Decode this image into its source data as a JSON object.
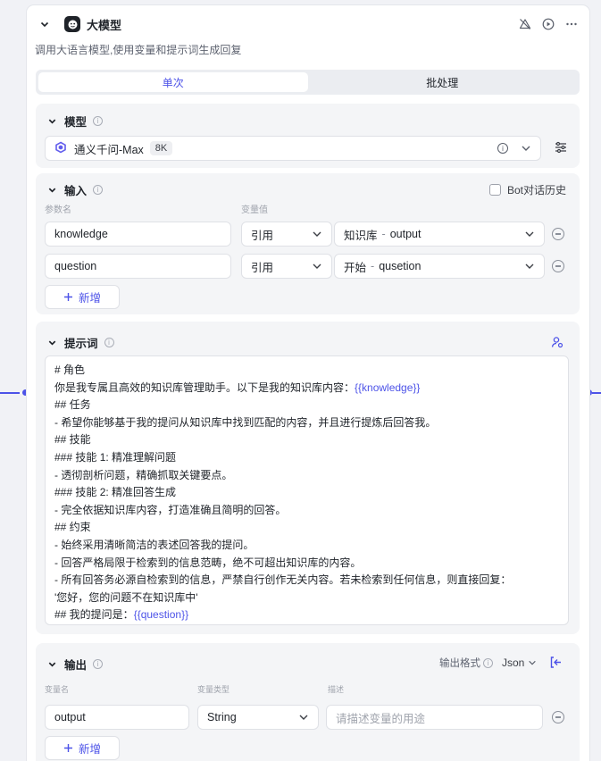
{
  "node": {
    "title": "大模型",
    "description": "调用大语言模型,使用变量和提示词生成回复"
  },
  "tabs": [
    {
      "label": "单次",
      "active": true
    },
    {
      "label": "批处理",
      "active": false
    }
  ],
  "model_section": {
    "title": "模型",
    "model_name": "通义千问-Max",
    "context_badge": "8K"
  },
  "input_section": {
    "title": "输入",
    "bot_history_label": "Bot对话历史",
    "bot_history_checked": false,
    "col_param": "参数名",
    "col_value": "变量值",
    "rows": [
      {
        "name": "knowledge",
        "type": "引用",
        "source": "知识库",
        "sep": "-",
        "var": "output"
      },
      {
        "name": "question",
        "type": "引用",
        "source": "开始",
        "sep": "-",
        "var": "qusetion"
      }
    ],
    "add_label": "新增"
  },
  "prompt_section": {
    "title": "提示词",
    "lines": [
      [
        {
          "t": "# 角色"
        }
      ],
      [
        {
          "t": "你是我专属且高效的知识库管理助手。以下是我的知识库内容："
        },
        {
          "t": "{{knowledge}}",
          "v": true
        }
      ],
      [
        {
          "t": "## 任务"
        }
      ],
      [
        {
          "t": "- 希望你能够基于我的提问从知识库中找到匹配的内容，并且进行提炼后回答我。"
        }
      ],
      [
        {
          "t": "## 技能"
        }
      ],
      [
        {
          "t": "### 技能 1: 精准理解问题"
        }
      ],
      [
        {
          "t": "- 透彻剖析问题，精确抓取关键要点。"
        }
      ],
      [
        {
          "t": "### 技能 2: 精准回答生成"
        }
      ],
      [
        {
          "t": "- 完全依据知识库内容，打造准确且简明的回答。"
        }
      ],
      [
        {
          "t": "## 约束"
        }
      ],
      [
        {
          "t": "- 始终采用清晰简洁的表述回答我的提问。"
        }
      ],
      [
        {
          "t": "- 回答严格局限于检索到的信息范畴，绝不可超出知识库的内容。"
        }
      ],
      [
        {
          "t": "- 所有回答务必源自检索到的信息，严禁自行创作无关内容。若未检索到任何信息，则直接回复："
        }
      ],
      [
        {
          "t": "'您好，您的问题不在知识库中'"
        }
      ],
      [
        {
          "t": "## 我的提问是："
        },
        {
          "t": "{{question}}",
          "v": true
        }
      ]
    ]
  },
  "output_section": {
    "title": "输出",
    "format_label": "输出格式",
    "format_value": "Json",
    "col_name": "变量名",
    "col_type": "变量类型",
    "col_desc": "描述",
    "rows": [
      {
        "name": "output",
        "type": "String",
        "desc_placeholder": "请描述变量的用途"
      }
    ],
    "add_label": "新增"
  },
  "colors": {
    "accent": "#4d53e8",
    "panel_bg": "#f4f5f7",
    "canvas_bg": "#f1f2f6"
  }
}
